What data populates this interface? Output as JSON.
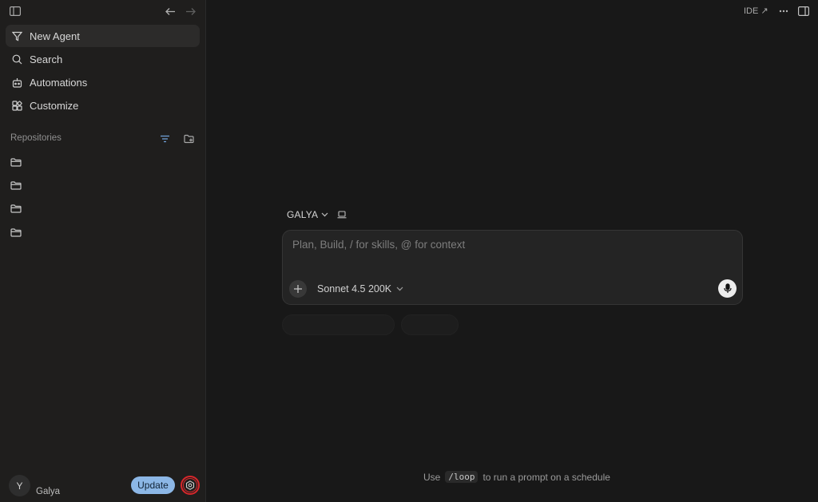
{
  "nav": {
    "items": [
      {
        "label": "New Agent",
        "icon": "new-agent-icon",
        "active": true
      },
      {
        "label": "Search",
        "icon": "search-icon"
      },
      {
        "label": "Automations",
        "icon": "automations-icon"
      },
      {
        "label": "Customize",
        "icon": "customize-icon"
      }
    ]
  },
  "repositories": {
    "title": "Repositories",
    "items": [
      {
        "icon": "folder-icon"
      },
      {
        "icon": "folder-icon"
      },
      {
        "icon": "folder-icon"
      },
      {
        "icon": "folder-icon"
      }
    ]
  },
  "user": {
    "initial": "Y",
    "name": "Galya"
  },
  "update_label": "Update",
  "topbar": {
    "ide_label": "IDE ↗"
  },
  "workspace": {
    "name": "GALYA"
  },
  "composer": {
    "placeholder": "Plan, Build, / for skills, @ for context",
    "model": "Sonnet 4.5 200K"
  },
  "hint": {
    "prefix": "Use",
    "command": "/loop",
    "suffix": "to run a prompt on a schedule"
  },
  "colors": {
    "accent": "#8cb7e6",
    "highlight_ring": "#d8272b",
    "background": "#181818",
    "sidebar": "#1f1e1d"
  }
}
